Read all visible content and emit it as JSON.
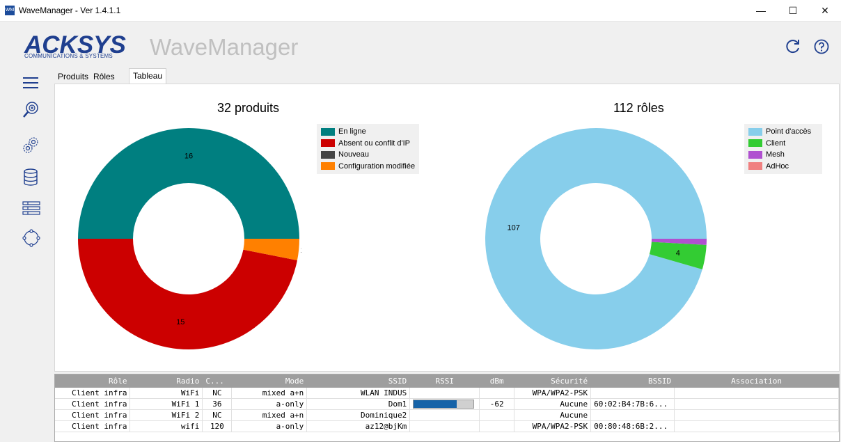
{
  "window": {
    "title": "WaveManager - Ver 1.4.1.1",
    "icon_text": "WM",
    "minimize": "—",
    "maximize": "☐",
    "close": "✕"
  },
  "header": {
    "logo": "ACKSYS",
    "logo_sub": "COMMUNICATIONS & SYSTEMS",
    "app_name": "WaveManager"
  },
  "tabs": [
    {
      "label": "Produits",
      "active": false
    },
    {
      "label": "Rôles",
      "active": false
    },
    {
      "label": "Tableau de bord",
      "active": true
    }
  ],
  "sidebar": {
    "items": [
      "menu-icon",
      "search-device-icon",
      "settings-icon",
      "database-icon",
      "list-icon",
      "network-icon"
    ]
  },
  "chart_data": [
    {
      "type": "pie",
      "title": "32 produits",
      "donut": true,
      "legend_position": "top-right",
      "labels": [
        "En ligne",
        "Absent ou conflit d'IP",
        "Nouveau",
        "Configuration modifiée"
      ],
      "values": [
        16,
        15,
        0,
        1
      ],
      "colors": [
        "#007f80",
        "#cc0000",
        "#444444",
        "#ff8000"
      ]
    },
    {
      "type": "pie",
      "title": "112 rôles",
      "donut": true,
      "legend_position": "top-right",
      "labels": [
        "Point d'accès",
        "Client",
        "Mesh",
        "AdHoc"
      ],
      "values": [
        107,
        4,
        1,
        0
      ],
      "colors": [
        "#87ceeb",
        "#33cc33",
        "#b050d0",
        "#f08080"
      ]
    }
  ],
  "table": {
    "columns": [
      "Rôle",
      "Radio",
      "C...",
      "Mode",
      "SSID",
      "RSSI",
      "dBm",
      "Sécurité",
      "BSSID",
      "Association"
    ],
    "rows": [
      {
        "role": "Client infra",
        "radio": "WiFi",
        "c": "NC",
        "mode": "mixed a+n",
        "ssid": "WLAN INDUS",
        "rssi": null,
        "dbm": "",
        "security": "WPA/WPA2-PSK",
        "bssid": "",
        "association": ""
      },
      {
        "role": "Client infra",
        "radio": "WiFi 1",
        "c": "36",
        "mode": "a-only",
        "ssid": "Dom1",
        "rssi": 0.72,
        "dbm": "-62",
        "security": "Aucune",
        "bssid": "60:02:B4:7B:6...",
        "association": ""
      },
      {
        "role": "Client infra",
        "radio": "WiFi 2",
        "c": "NC",
        "mode": "mixed a+n",
        "ssid": "Dominique2",
        "rssi": null,
        "dbm": "",
        "security": "Aucune",
        "bssid": "",
        "association": ""
      },
      {
        "role": "Client infra",
        "radio": "wifi",
        "c": "120",
        "mode": "a-only",
        "ssid": "az12@bjKm",
        "rssi": null,
        "dbm": "",
        "security": "WPA/WPA2-PSK",
        "bssid": "00:80:48:6B:2...",
        "association": ""
      }
    ]
  }
}
